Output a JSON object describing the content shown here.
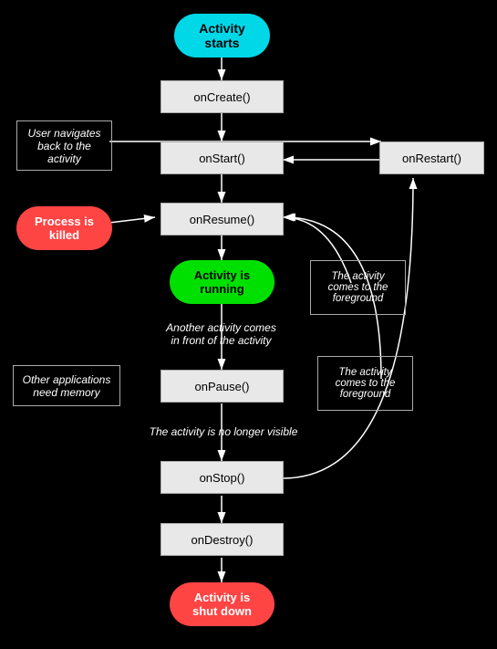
{
  "nodes": {
    "activity_starts": {
      "label": "Activity\nstarts"
    },
    "onCreate": {
      "label": "onCreate()"
    },
    "onStart": {
      "label": "onStart()"
    },
    "onRestart": {
      "label": "onRestart()"
    },
    "onResume": {
      "label": "onResume()"
    },
    "activity_running": {
      "label": "Activity is\nrunning"
    },
    "onPause": {
      "label": "onPause()"
    },
    "onStop": {
      "label": "onStop()"
    },
    "onDestroy": {
      "label": "onDestroy()"
    },
    "activity_shutdown": {
      "label": "Activity is\nshut down"
    },
    "user_navigates": {
      "label": "User navigates\nback to the\nactivity"
    },
    "process_killed": {
      "label": "Process is\nkilled"
    },
    "another_activity": {
      "label": "Another activity comes\nin front of the activity"
    },
    "other_apps": {
      "label": "Other applications\nneed memory"
    },
    "no_longer_visible": {
      "label": "The activity is no longer visible"
    },
    "activity_foreground1": {
      "label": "The activity\ncomes to the\nforeground"
    },
    "activity_foreground2": {
      "label": "The activity\ncomes to the\nforeground"
    }
  }
}
